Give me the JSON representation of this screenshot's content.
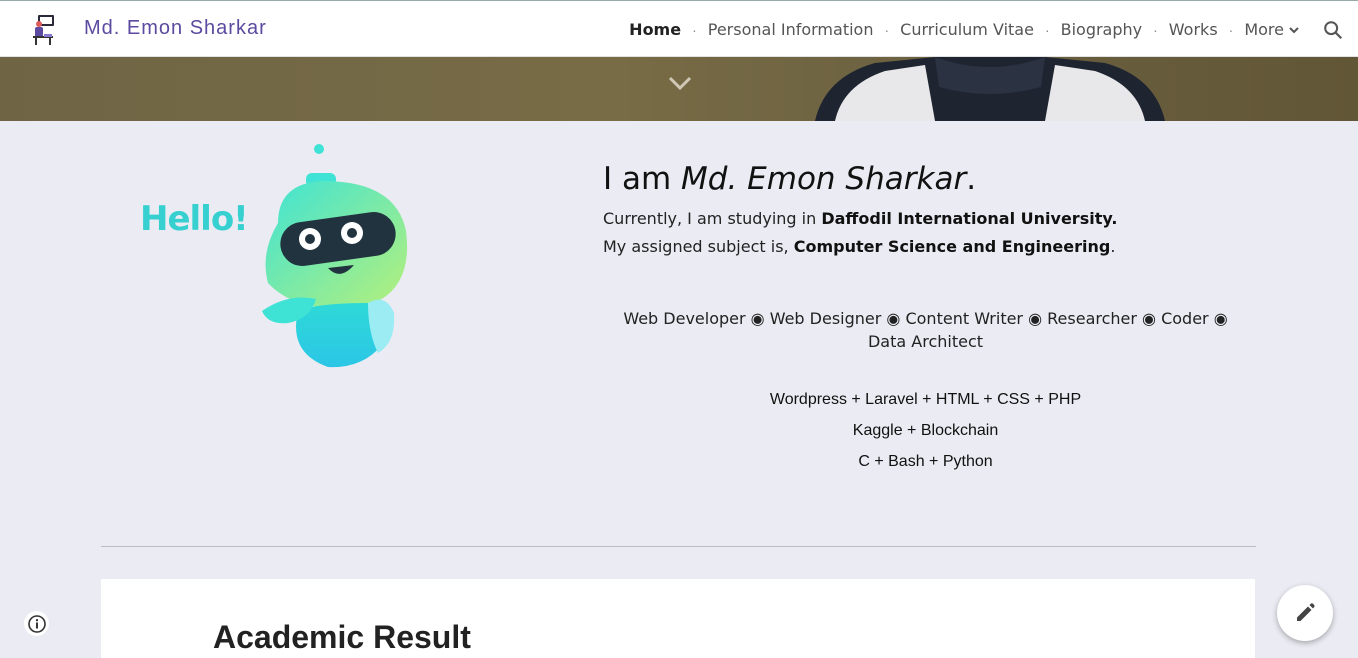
{
  "header": {
    "site_title": "Md. Emon Sharkar",
    "nav": [
      {
        "label": "Home",
        "active": true
      },
      {
        "label": "Personal Information"
      },
      {
        "label": "Curriculum Vitae"
      },
      {
        "label": "Biography"
      },
      {
        "label": "Works"
      }
    ],
    "more_label": "More",
    "icons": {
      "logo": "person-at-desk-logo",
      "more": "chevron-down-icon",
      "search": "search-icon"
    }
  },
  "banner": {
    "scroll_icon": "chevron-down-icon"
  },
  "hero": {
    "robot_text": "Hello!",
    "heading_prefix": "I am ",
    "heading_name": "Md. Emon Sharkar",
    "heading_suffix": ".",
    "line1_prefix": "Currently, I am studying in ",
    "line1_bold": "Daffodil International University.",
    "line2_prefix": "My assigned subject is, ",
    "line2_bold": "Computer Science and Engineering",
    "line2_suffix": ".",
    "roles": "Web Developer ◉ Web Designer ◉ Content Writer ◉ Researcher ◉ Coder ◉ Data Architect",
    "stack": [
      "Wordpress + Laravel + HTML + CSS + PHP",
      "Kaggle + Blockchain",
      "C + Bash + Python"
    ]
  },
  "section": {
    "title": "Academic Result"
  },
  "fab": {
    "info_icon": "info-icon",
    "edit_icon": "pencil-icon"
  },
  "colors": {
    "brand": "#5b4aa0",
    "hello": "#35d0cf",
    "page_bg": "#ebebf3"
  }
}
